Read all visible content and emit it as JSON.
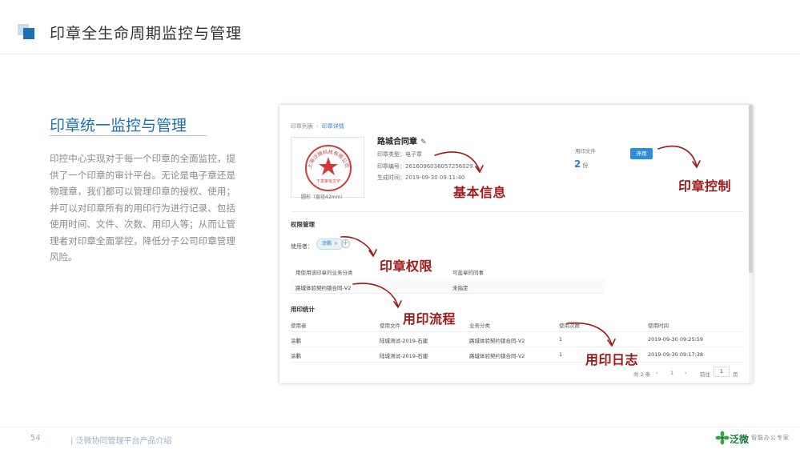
{
  "header": {
    "title": "印章全生命周期监控与管理"
  },
  "section": {
    "title": "印章统一监控与管理",
    "description": "印控中心实现对于每一个印章的全面监控，提供了一个印章的审计平台。无论是电子章还是物理章，我们都可以管理印章的授权、使用；并可以对印章所有的用印行为进行记录、包括使用时间、文件、次数、用印人等；从而让管理者对印章全面掌控，降低分子公司印章管理风险。"
  },
  "panel": {
    "breadcrumb": {
      "list": "印章列表",
      "sep": "›",
      "current": "印章详情"
    },
    "seal": {
      "ring_text": "上海泛微科技有限公司",
      "bottom_text": "下发审批文字",
      "caption": "圆形（直径42mm）"
    },
    "name": "路城合同章",
    "info": {
      "type": "印章类型：电子章",
      "number": "印章编号：2616096036057256029",
      "created": "生成时间：2019-09-30 09:11:40"
    },
    "files": {
      "label": "用印文件",
      "count": "2",
      "unit": "份"
    },
    "stop_button": "停用",
    "permission": {
      "title": "权限管理",
      "user_label": "使用者：",
      "user_tag": "涂鹏",
      "tag_close": "×",
      "add": "+",
      "headers": [
        "用使用该印章的业务分类",
        "可盖章的同事"
      ],
      "row": [
        "路城体验契约锁合同-V2",
        "未指定"
      ]
    },
    "stats": {
      "title": "用印统计",
      "headers": [
        "使用者",
        "使用文件",
        "业务分类",
        "使用次数",
        "使用时间"
      ],
      "rows": [
        [
          "涂鹏",
          "陆城测试-2019-石建",
          "路城体验契约锁合同-V2",
          "1",
          "2019-09-30 09:25:59"
        ],
        [
          "涂鹏",
          "陆城测试-2019-石建",
          "路城体验契约锁合同-V2",
          "1",
          "2019-09-30 09:17:38"
        ]
      ]
    },
    "pager": {
      "total": "共 2 条",
      "prev": "‹",
      "page": "1",
      "next": "›",
      "goto": "前往",
      "input": "1",
      "suffix": "页"
    }
  },
  "callouts": {
    "basic": "基本信息",
    "control": "印章控制",
    "permission": "印章权限",
    "flow": "用印流程",
    "log": "用印日志"
  },
  "colors": {
    "accent": "#1e6fb4",
    "callout": "#a01818",
    "link": "#2a7fd4"
  },
  "footer": {
    "page": "54",
    "text": "|  泛微协同管理平台产品介绍",
    "logo": "泛微",
    "slogan": "智能办公专家"
  }
}
